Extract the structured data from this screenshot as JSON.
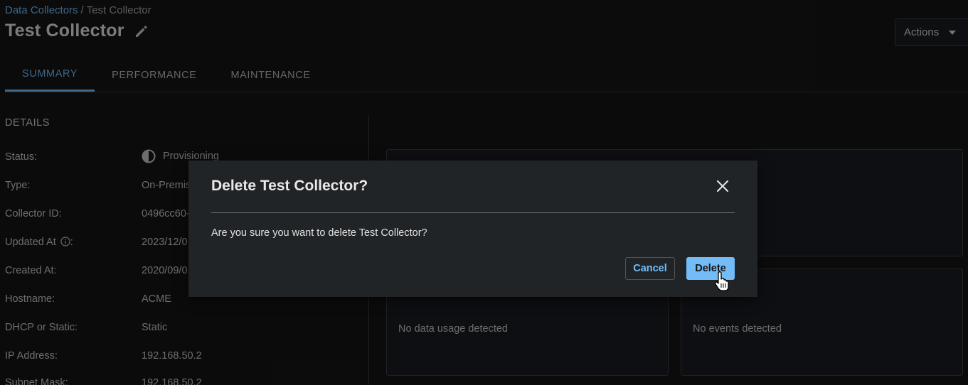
{
  "breadcrumb": {
    "parent": "Data Collectors",
    "separator": "/",
    "current": "Test Collector"
  },
  "header": {
    "title": "Test Collector",
    "edit_icon": "pencil-icon",
    "actions_label": "Actions"
  },
  "tabs": [
    {
      "label": "SUMMARY",
      "active": true
    },
    {
      "label": "PERFORMANCE",
      "active": false
    },
    {
      "label": "MAINTENANCE",
      "active": false
    }
  ],
  "details": {
    "heading": "DETAILS",
    "rows": [
      {
        "label": "Status:",
        "value": "Provisioning"
      },
      {
        "label": "Type:",
        "value": "On-Premis"
      },
      {
        "label": "Collector ID:",
        "value": "0496cc60-"
      },
      {
        "label": "Updated At",
        "suffix": ":",
        "value": "2023/12/0"
      },
      {
        "label": "Created At:",
        "value": "2020/09/0"
      },
      {
        "label": "Hostname:",
        "value": "ACME"
      },
      {
        "label": "DHCP or Static:",
        "value": "Static"
      },
      {
        "label": "IP Address:",
        "value": "192.168.50.2"
      },
      {
        "label": "Subnet Mask:",
        "value": "192.168.50.2"
      }
    ]
  },
  "cards": {
    "data_usage_empty": "No data usage detected",
    "events_empty": "No events detected"
  },
  "modal": {
    "title": "Delete Test Collector?",
    "body": "Are you sure you want to delete Test Collector?",
    "cancel_label": "Cancel",
    "delete_label": "Delete"
  },
  "colors": {
    "accent": "#73bcf7",
    "background": "#151515"
  }
}
